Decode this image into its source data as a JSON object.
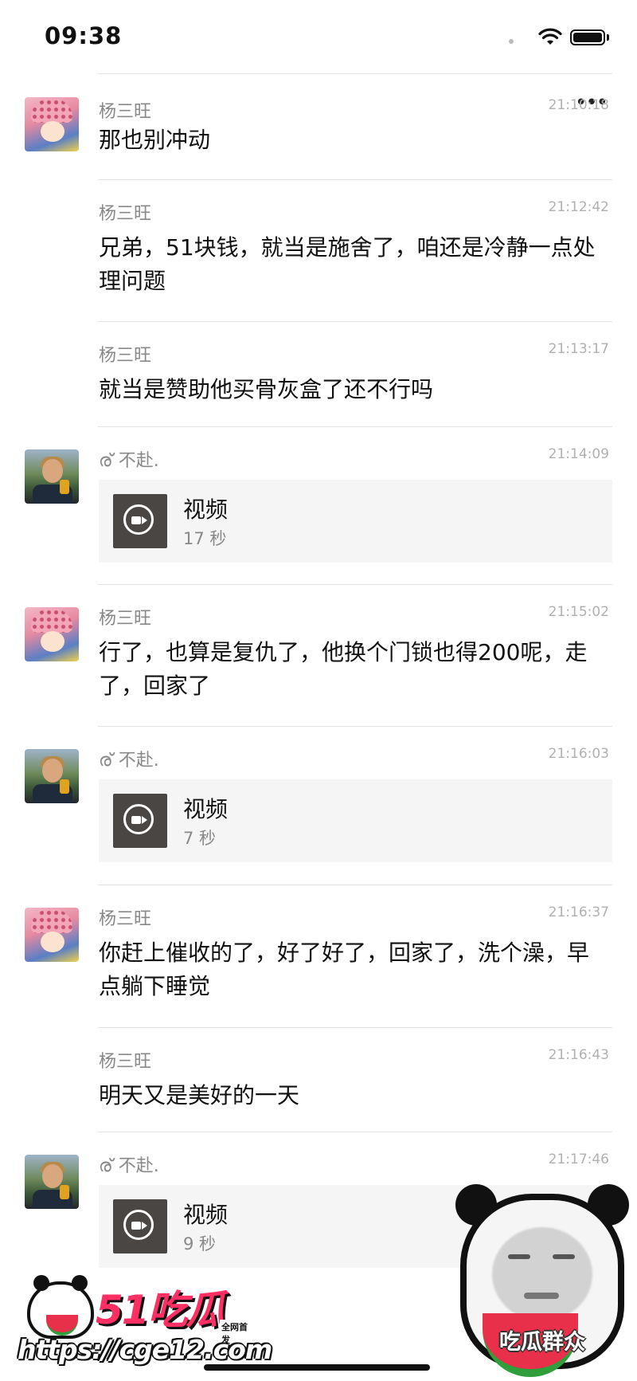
{
  "status_bar": {
    "time": "09:38"
  },
  "messages": [
    {
      "kind": "text",
      "sender": "杨三旺",
      "time": "21:10:18",
      "text": "那也别冲动"
    },
    {
      "kind": "text",
      "sender": "杨三旺",
      "time": "21:12:42",
      "text": "兄弟，51块钱，就当是施舍了，咱还是冷静一点处理问题"
    },
    {
      "kind": "text",
      "sender": "杨三旺",
      "time": "21:13:17",
      "text": "就当是赞助他买骨灰盒了还不行吗"
    },
    {
      "kind": "video",
      "sender": "ര് 不赴.",
      "time": "21:14:09",
      "video_label": "视频",
      "duration": "17 秒"
    },
    {
      "kind": "text",
      "sender": "杨三旺",
      "time": "21:15:02",
      "text": "行了，也算是复仇了，他换个门锁也得200呢，走了，回家了"
    },
    {
      "kind": "video",
      "sender": "ര് 不赴.",
      "time": "21:16:03",
      "video_label": "视频",
      "duration": "7 秒"
    },
    {
      "kind": "text",
      "sender": "杨三旺",
      "time": "21:16:37",
      "text": "你赶上催收的了，好了好了，回家了，洗个澡，早点躺下睡觉"
    },
    {
      "kind": "text",
      "sender": "杨三旺",
      "time": "21:16:43",
      "text": "明天又是美好的一天"
    },
    {
      "kind": "video",
      "sender": "ര് 不赴.",
      "time": "21:17:46",
      "video_label": "视频",
      "duration": "9 秒"
    }
  ],
  "watermark": {
    "brand": "51吃瓜",
    "tag": "全网首发",
    "url": "https://cge12.com"
  },
  "meme": {
    "label": "吃瓜群众"
  },
  "icons": [
    "back-chevron-icon",
    "more-dots-icon",
    "wifi-icon",
    "battery-icon",
    "video-camera-icon"
  ]
}
